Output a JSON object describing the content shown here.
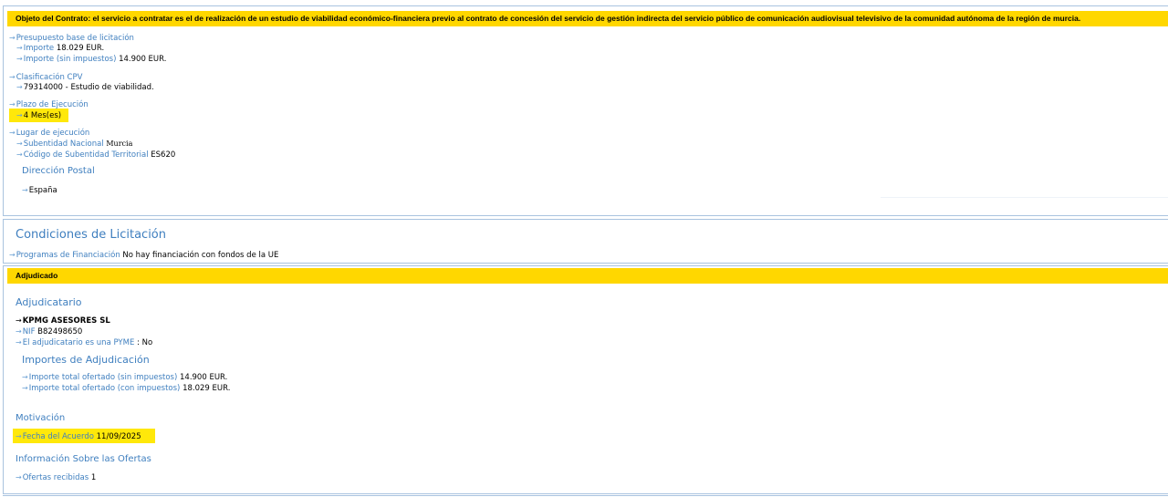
{
  "contrato": {
    "objeto_label": "Objeto del Contrato:",
    "objeto_texto": "el servicio a contratar es el de realización de un estudio de viabilidad económico-financiera previo al contrato de concesión del servicio de gestión indirecta del servicio público de comunicación audiovisual televisivo de la comunidad autónoma de la región de murcia."
  },
  "presupuesto": {
    "title": "Presupuesto base de licitación",
    "importe_label": "Importe",
    "importe_value": "18.029 EUR.",
    "sin_impuestos_label": "Importe (sin impuestos)",
    "sin_impuestos_value": "14.900 EUR."
  },
  "cpv": {
    "title": "Clasificación CPV",
    "value": "79314000 - Estudio de viabilidad."
  },
  "plazo": {
    "title": "Plazo de Ejecución",
    "value": "4 Mes(es)"
  },
  "lugar": {
    "title": "Lugar de ejecución",
    "subentidad_label": "Subentidad Nacional",
    "subentidad_value": "Murcia",
    "codigo_label": "Código de Subentidad Territorial",
    "codigo_value": "ES620",
    "direccion_heading": "Dirección Postal",
    "pais": "España"
  },
  "condiciones": {
    "heading": "Condiciones de Licitación",
    "programas_label": "Programas de Financiación",
    "programas_value": "No hay financiación con fondos de la UE"
  },
  "adjudicado": {
    "bar_label": "Adjudicado",
    "adjudicatario_heading": "Adjudicatario",
    "empresa": "KPMG ASESORES SL",
    "nif_label": "NIF",
    "nif_value": "B82498650",
    "pyme_label": "El adjudicatario es una PYME",
    "pyme_sep": ":",
    "pyme_value": "No",
    "importes_heading": "Importes de Adjudicación",
    "total_sin_label": "Importe total ofertado (sin impuestos)",
    "total_sin_value": "14.900 EUR.",
    "total_con_label": "Importe total ofertado (con impuestos)",
    "total_con_value": "18.029 EUR.",
    "motivacion_heading": "Motivación",
    "fecha_label": "Fecha del Acuerdo",
    "fecha_value": "11/09/2025",
    "info_heading": "Información Sobre las Ofertas",
    "ofertas_label": "Ofertas recibidas",
    "ofertas_value": "1"
  },
  "icons": {
    "arrow": "→"
  },
  "colors": {
    "highlight": "#ffd700",
    "link": "#3f7fbf",
    "border": "#a9c3df"
  }
}
